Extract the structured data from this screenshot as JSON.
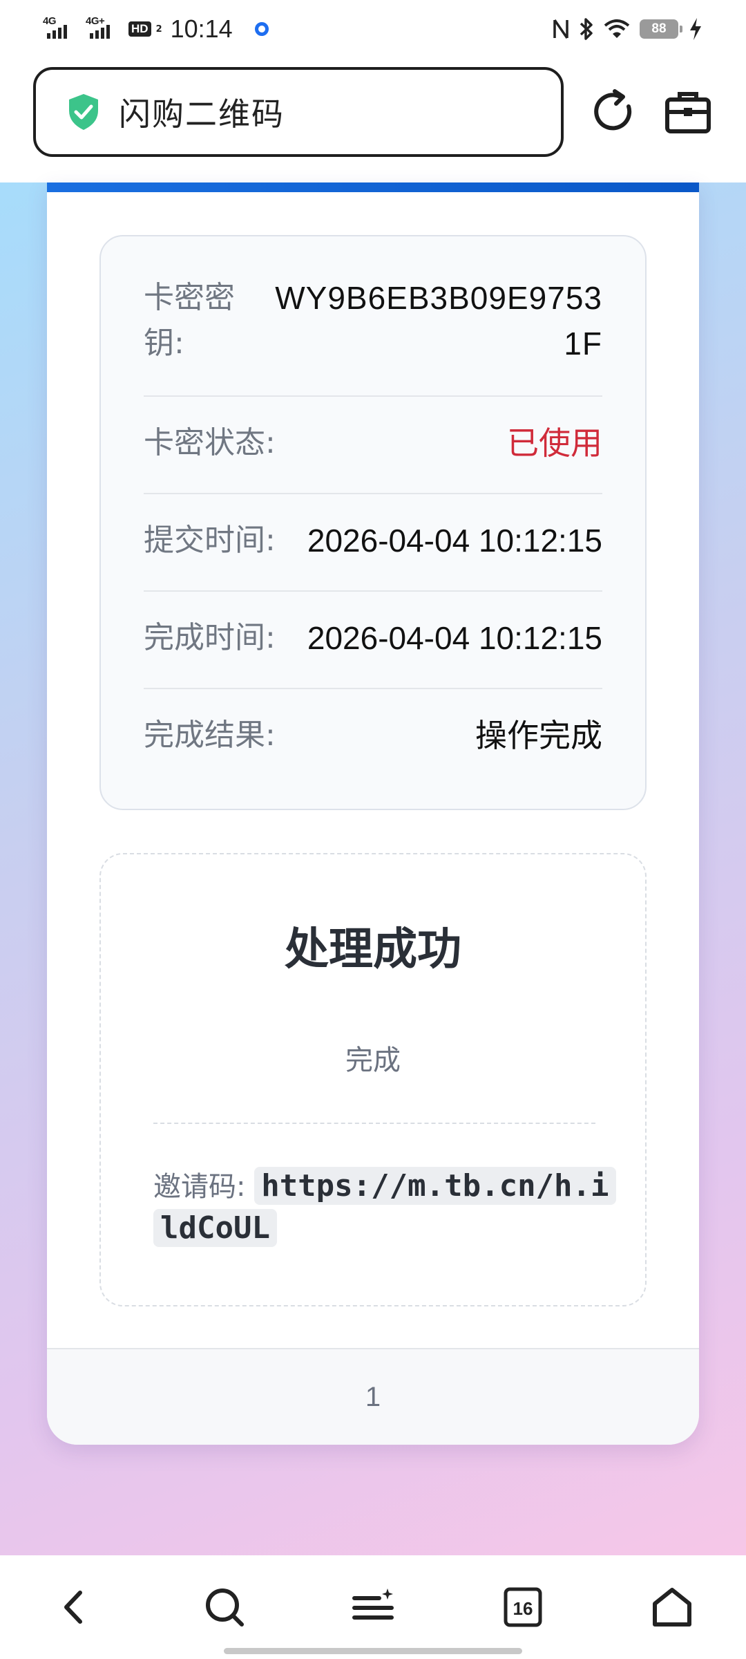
{
  "status_bar": {
    "network1": "4G",
    "network2": "4G+",
    "hd_label": "HD",
    "hd_sub": "2",
    "time": "10:14",
    "battery": "88"
  },
  "browser": {
    "address_text": "闪购二维码",
    "tab_count": "16"
  },
  "card_info": {
    "rows": [
      {
        "label": "卡密密钥:",
        "value": "WY9B6EB3B09E97531F"
      },
      {
        "label": "卡密状态:",
        "value": "已使用",
        "status_color": "#d02b3a"
      },
      {
        "label": "提交时间:",
        "value": "2026-04-04 10:12:15"
      },
      {
        "label": "完成时间:",
        "value": "2026-04-04 10:12:15"
      },
      {
        "label": "完成结果:",
        "value": "操作完成"
      }
    ]
  },
  "result": {
    "title": "处理成功",
    "subtitle": "完成",
    "invite_label": "邀请码:",
    "invite_code": "https://m.tb.cn/h.ildCoUL"
  },
  "footer": {
    "page_number": "1"
  },
  "icons": {
    "address_icon": "shield-check-icon",
    "top_right": [
      "refresh-icon",
      "toolbox-icon"
    ],
    "bottom_nav": [
      "back-icon",
      "search-icon",
      "menu-icon",
      "tabs-icon",
      "home-icon"
    ]
  },
  "colors": {
    "accent": "#1a6fe0",
    "status_used": "#d02b3a",
    "shield": "#3cc48a"
  }
}
